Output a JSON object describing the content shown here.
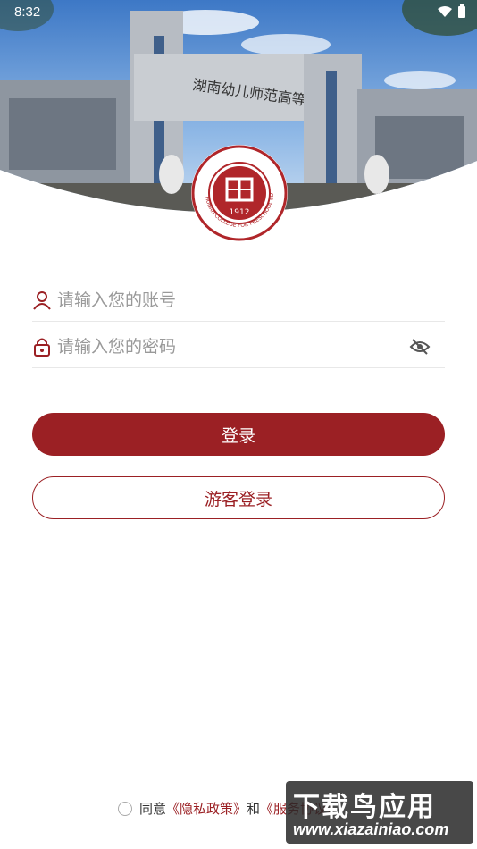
{
  "status_bar": {
    "time": "8:32"
  },
  "hero": {
    "gate_text": "湖南幼儿师范高等专科学校",
    "logo_ring_text": "HUNAN COLLEGE FOR PRESCHOOL EDUCATION",
    "logo_year": "1912",
    "logo_top_text": "湖南幼儿师范高等专科学校"
  },
  "form": {
    "account_placeholder": "请输入您的账号",
    "password_placeholder": "请输入您的密码",
    "account_icon": "user-icon",
    "password_icon": "lock-icon",
    "visibility_icon": "eye-off-icon"
  },
  "buttons": {
    "login_label": "登录",
    "guest_label": "游客登录"
  },
  "agreement": {
    "prefix": "同意",
    "privacy_link": "《隐私政策》",
    "conjunction": "和",
    "service_link": "《服务协议》"
  },
  "watermark": {
    "title": "下载鸟应用",
    "url": "www.xiazainiao.com"
  },
  "colors": {
    "brand": "#9b2024",
    "placeholder": "#999999",
    "divider": "#e8e8e8"
  }
}
